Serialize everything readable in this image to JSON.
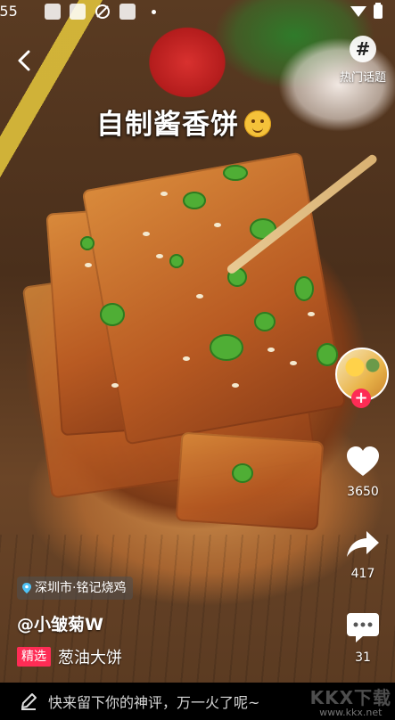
{
  "status_bar": {
    "time": ":55"
  },
  "video": {
    "title": "自制酱香饼",
    "author": "@小皱菊W",
    "badge": "精选",
    "description": "葱油大饼",
    "location": "深圳市·铭记烧鸡"
  },
  "right_rail": {
    "topic_symbol": "#",
    "topic_label": "热门话题",
    "follow_symbol": "+",
    "like_count": "3650",
    "share_count": "417",
    "comment_count": "31"
  },
  "comment_bar": {
    "placeholder": "快来留下你的神评，万一火了呢~"
  },
  "watermark": {
    "brand": "KKX下载",
    "url": "www.kkx.net"
  },
  "colors": {
    "accent": "#fe2c55",
    "background": "#000000"
  }
}
